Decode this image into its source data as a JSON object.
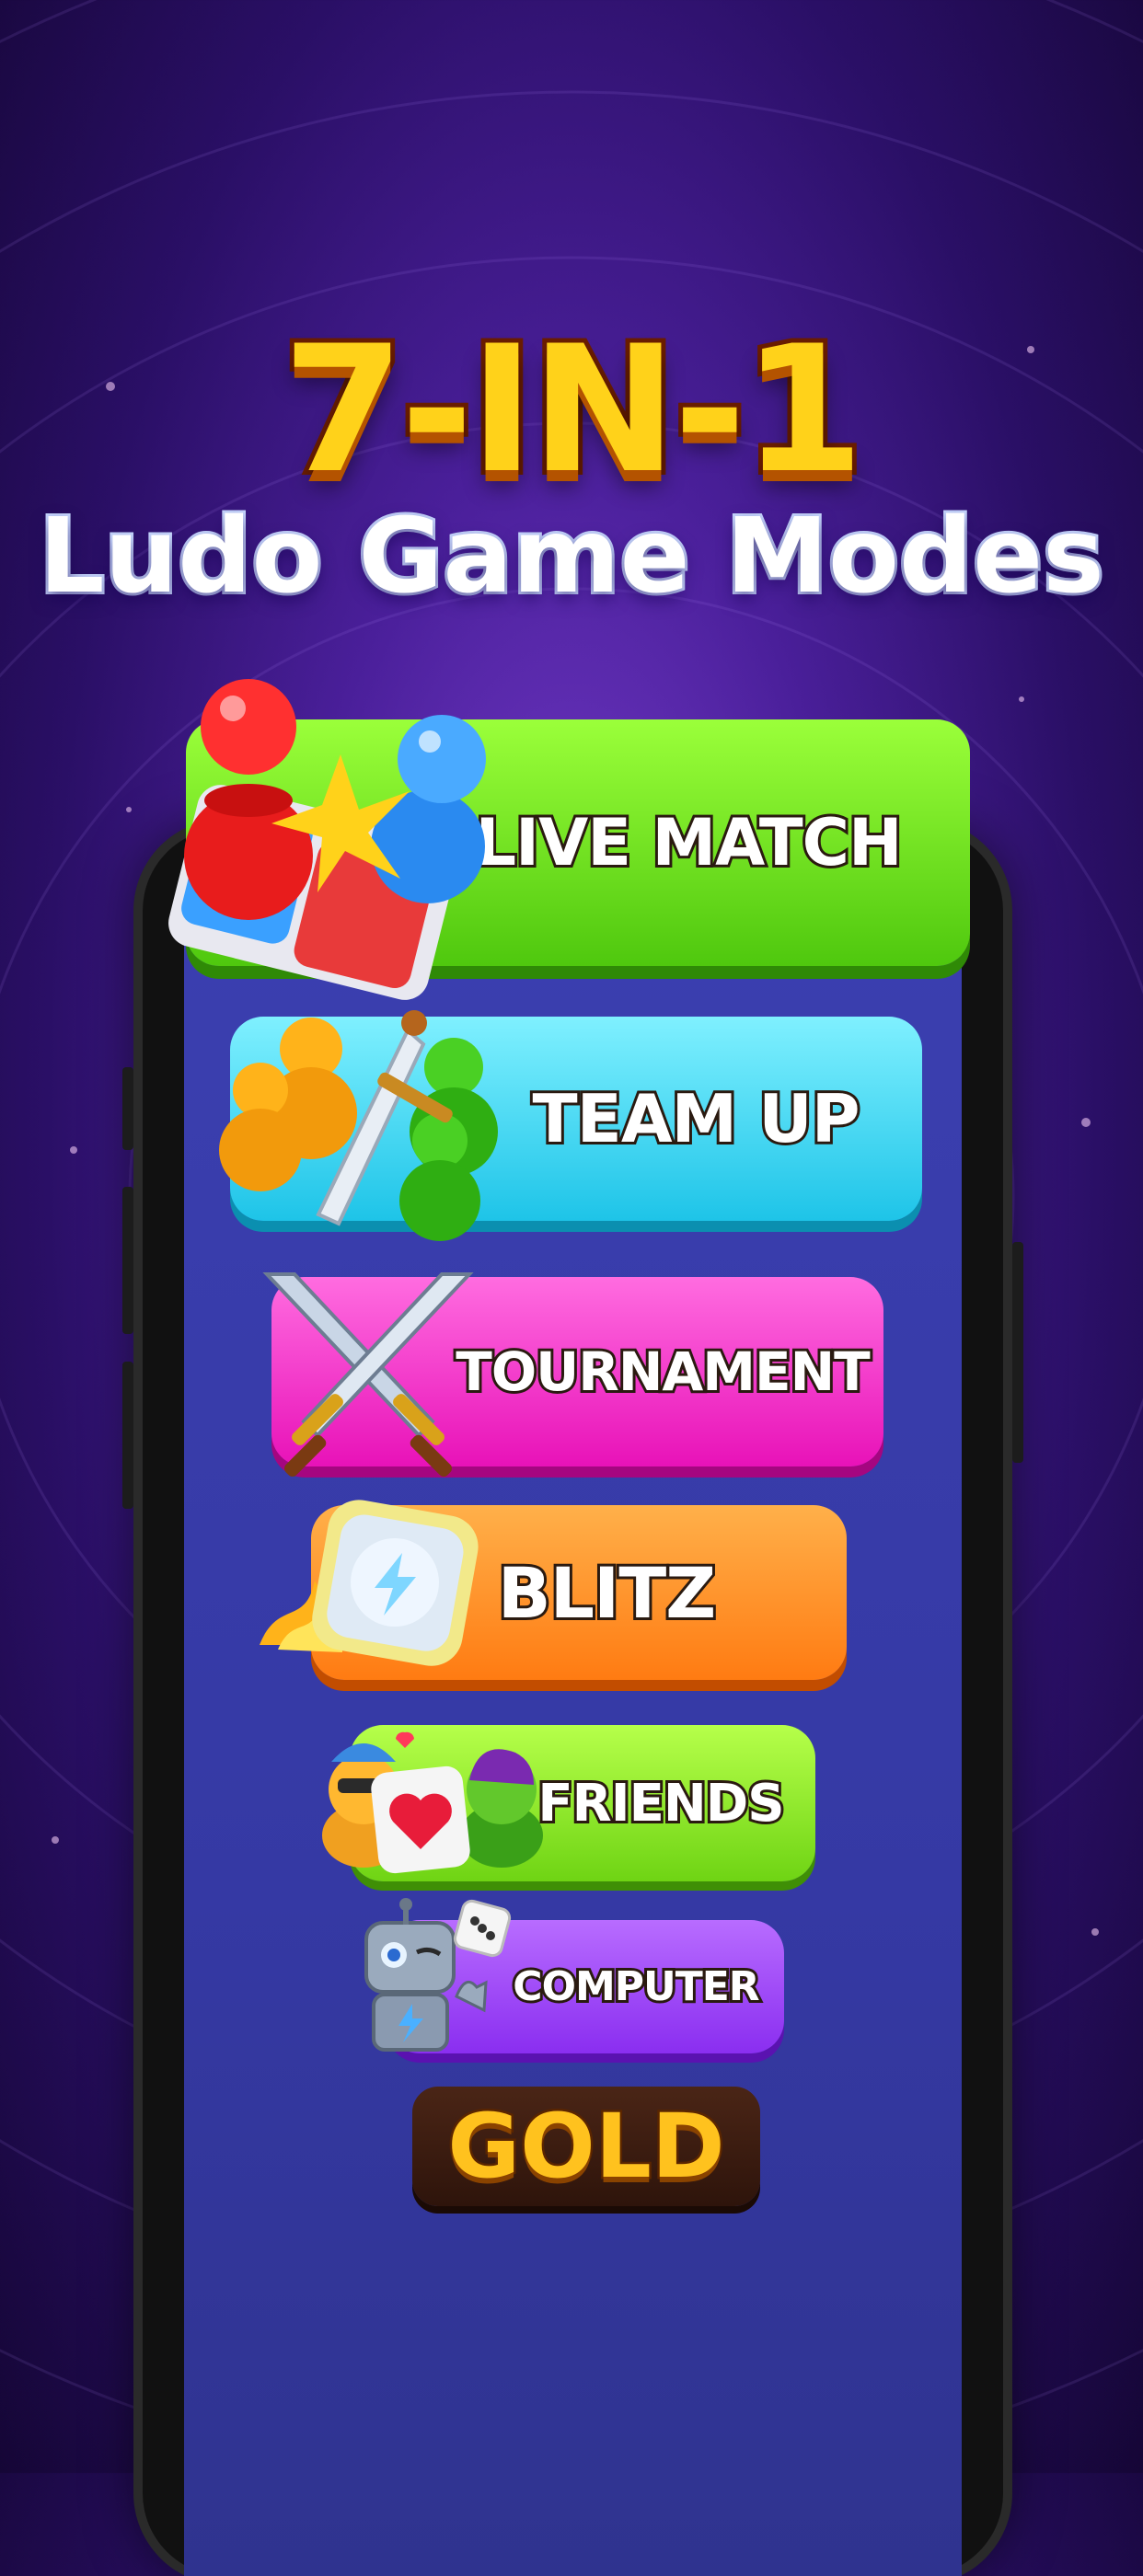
{
  "headline": {
    "title": "7-IN-1",
    "subtitle": "Ludo Game Modes"
  },
  "modes": [
    {
      "label": "LIVE MATCH",
      "color": "#6ee21c",
      "icon": "ludo-pawns-board-icon"
    },
    {
      "label": "TEAM UP",
      "color": "#2cd6f2",
      "icon": "pawns-sword-icon"
    },
    {
      "label": "TOURNAMENT",
      "color": "#f22cc2",
      "icon": "crossed-swords-icon"
    },
    {
      "label": "BLITZ",
      "color": "#ff8a1c",
      "icon": "lightning-timer-icon"
    },
    {
      "label": "FRIENDS",
      "color": "#86e21c",
      "icon": "friends-hearts-icon"
    },
    {
      "label": "COMPUTER",
      "color": "#9a3cf0",
      "icon": "robot-dice-icon"
    }
  ],
  "gold_button": {
    "label": "GOLD"
  }
}
